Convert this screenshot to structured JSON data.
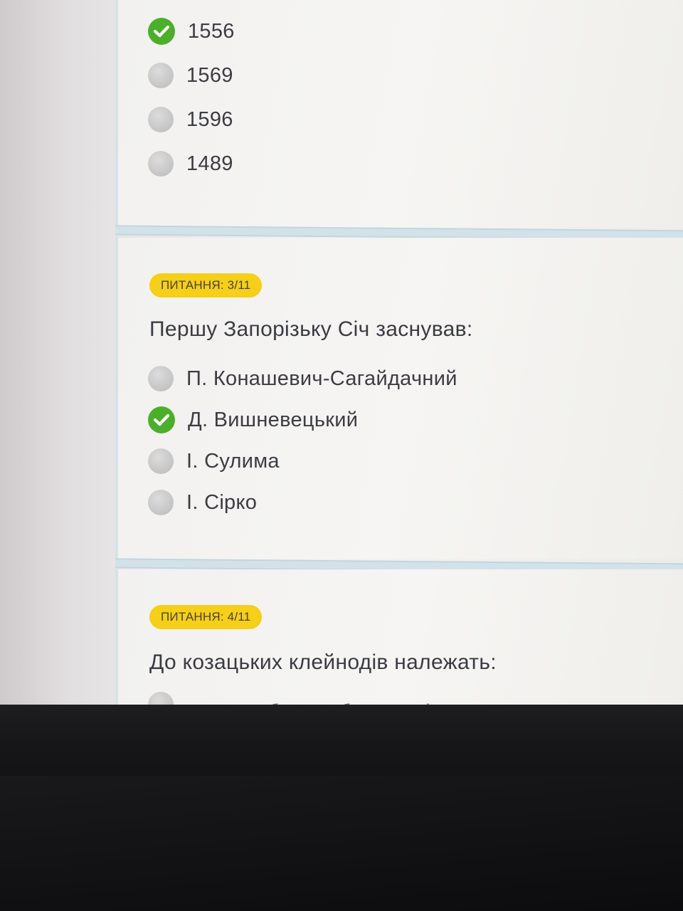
{
  "q2": {
    "options": [
      {
        "label": "1556",
        "state": "correct"
      },
      {
        "label": "1569",
        "state": "unselected"
      },
      {
        "label": "1596",
        "state": "unselected"
      },
      {
        "label": "1489",
        "state": "unselected"
      }
    ]
  },
  "q3": {
    "badge": "ПИТАННЯ: 3/11",
    "text": "Першу Запорізьку Січ заснував:",
    "options": [
      {
        "label": "П. Конашевич-Сагайдачний",
        "state": "unselected"
      },
      {
        "label": "Д. Вишневецький",
        "state": "correct"
      },
      {
        "label": "І. Сулима",
        "state": "unselected"
      },
      {
        "label": "І. Сірко",
        "state": "unselected"
      }
    ]
  },
  "q4": {
    "badge": "ПИТАННЯ: 4/11",
    "text": "До козацьких клейнодів належать:",
    "options": [
      {
        "label": "корогва, бунчук, булава, пірнач, литаври, печатка",
        "state": "unselected"
      }
    ]
  },
  "colors": {
    "badge": "#f5cf18",
    "correct": "#4caf2a",
    "separator": "#d3e2e9"
  },
  "icons": {
    "correct": "check-circle-icon",
    "unselected": "radio-empty-icon"
  }
}
